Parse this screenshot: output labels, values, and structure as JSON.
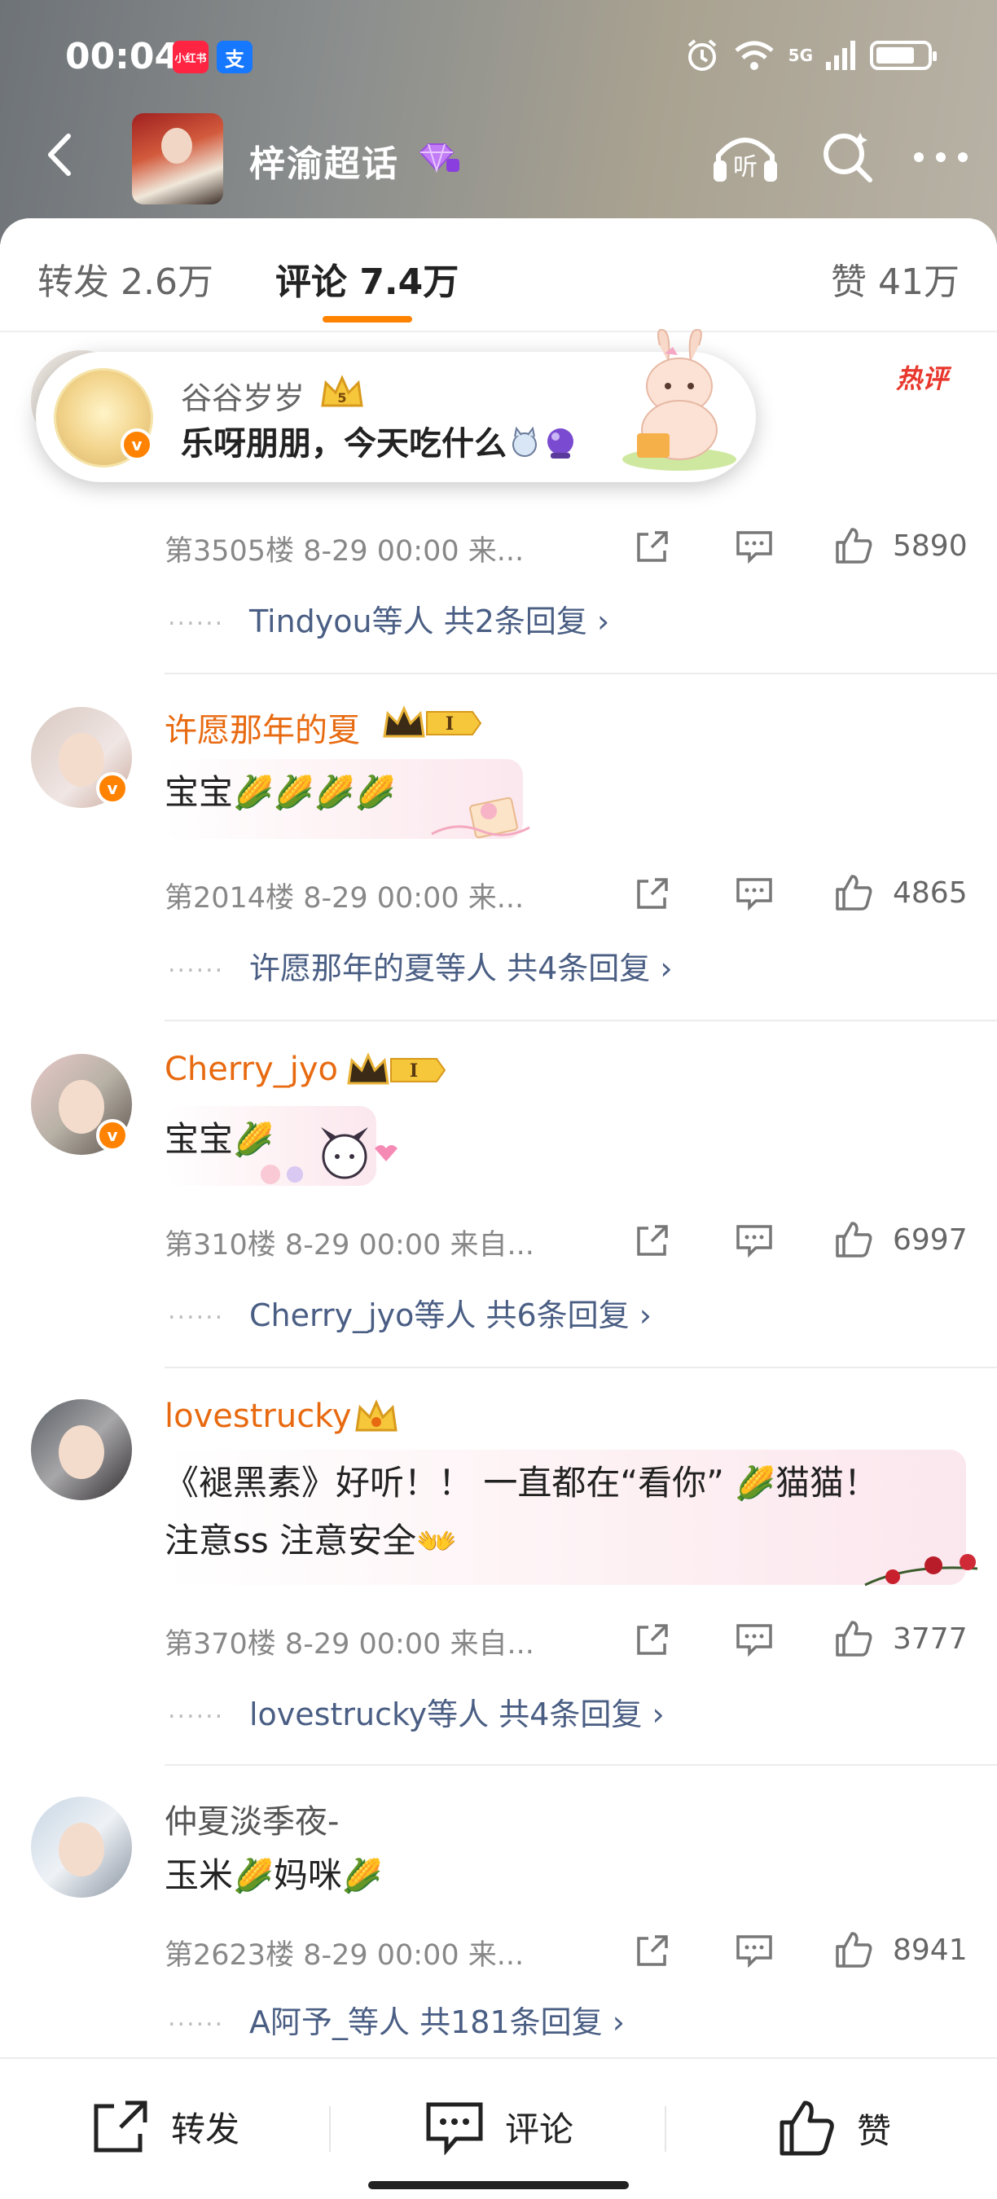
{
  "status_bar": {
    "time": "00:04",
    "app_badge_red": "小红书",
    "app_badge_blue": "支",
    "network": "5G"
  },
  "nav": {
    "title": "梓渝超话"
  },
  "tabs": {
    "repost": "转发 2.6万",
    "comment": "评论 7.4万",
    "like": "赞 41万"
  },
  "toast": {
    "user": "谷谷岁岁",
    "text": "乐呀朋朋，今天吃什么"
  },
  "hot_label": "热评",
  "comments": [
    {
      "name": "",
      "text": "",
      "meta": "第3505楼 8-29 00:00 来...",
      "likes": "5890",
      "reply_user": "Tindyou等人",
      "reply_count": "共2条回复"
    },
    {
      "name": "许愿那年的夏",
      "text": "宝宝",
      "meta": "第2014楼 8-29 00:00 来...",
      "likes": "4865",
      "reply_user": "许愿那年的夏等人",
      "reply_count": "共4条回复"
    },
    {
      "name": "Cherry_jyo",
      "text": "宝宝",
      "meta": "第310楼 8-29 00:00 来自...",
      "likes": "6997",
      "reply_user": "Cherry_jyo等人",
      "reply_count": "共6条回复"
    },
    {
      "name": "lovestrucky",
      "text_line1_a": "《褪黑素》好听！！ 一直都在“看你” ",
      "text_line1_b": "猫猫！",
      "text_line2": "注意ss 注意安全",
      "meta": "第370楼 8-29 00:00 来自...",
      "likes": "3777",
      "reply_user": "lovestrucky等人",
      "reply_count": "共4条回复"
    },
    {
      "name": "仲夏淡季夜-",
      "text_a": "玉米",
      "text_b": "妈咪",
      "meta": "第2623楼 8-29 00:00 来...",
      "likes": "8941",
      "reply_user": "A阿予_等人",
      "reply_count": "共181条回复"
    }
  ],
  "reply_dots": "......",
  "reply_arrow": "›",
  "bottom_bar": {
    "repost": "转发",
    "comment": "评论",
    "like": "赞"
  },
  "icons": {
    "corn": "🌽",
    "open_hands": "👐",
    "gem": "purple-gem-icon"
  }
}
